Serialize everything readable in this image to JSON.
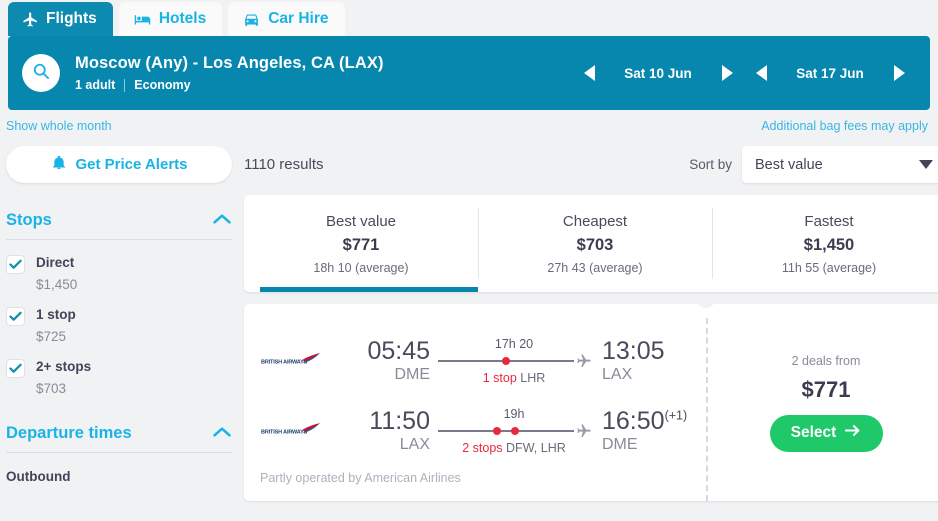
{
  "tabs": [
    {
      "label": "Flights",
      "icon": "plane-icon",
      "active": true
    },
    {
      "label": "Hotels",
      "icon": "bed-icon",
      "active": false
    },
    {
      "label": "Car Hire",
      "icon": "car-icon",
      "active": false
    }
  ],
  "search": {
    "icon": "search-icon",
    "route": "Moscow (Any) - Los Angeles, CA (LAX)",
    "passengers": "1 adult",
    "cabin": "Economy",
    "depart_date": "Sat 10 Jun",
    "return_date": "Sat 17 Jun",
    "prev_icon": "chevron-left-icon",
    "next_icon": "chevron-right-icon"
  },
  "links": {
    "show_whole_month": "Show whole month",
    "bag_fees": "Additional bag fees may apply"
  },
  "toolbar": {
    "price_alerts": "Get Price Alerts",
    "bell_icon": "bell-icon",
    "results_count": "1110 results",
    "sort_label": "Sort by",
    "sort_value": "Best value",
    "sort_caret": "chevron-down-icon"
  },
  "compare": [
    {
      "name": "Best value",
      "price": "$771",
      "duration": "18h 10 (average)",
      "active": true
    },
    {
      "name": "Cheapest",
      "price": "$703",
      "duration": "27h 43 (average)",
      "active": false
    },
    {
      "name": "Fastest",
      "price": "$1,450",
      "duration": "11h 55 (average)",
      "active": false
    }
  ],
  "filters": {
    "stops": {
      "title": "Stops",
      "chevron": "chevron-up-icon",
      "options": [
        {
          "label": "Direct",
          "price": "$1,450",
          "checked": true
        },
        {
          "label": "1 stop",
          "price": "$725",
          "checked": true
        },
        {
          "label": "2+ stops",
          "price": "$703",
          "checked": true
        }
      ]
    },
    "departure_times": {
      "title": "Departure times",
      "chevron": "chevron-up-icon",
      "outbound_label": "Outbound"
    }
  },
  "result": {
    "airline_logo": "british-airways-logo",
    "legs": [
      {
        "depart_time": "05:45",
        "depart_code": "DME",
        "duration": "17h 20",
        "stops_count": "1 stop",
        "stops_codes": "LHR",
        "stop_dots": 1,
        "arrive_time": "13:05",
        "arrive_day_offset": "",
        "arrive_code": "LAX"
      },
      {
        "depart_time": "11:50",
        "depart_code": "LAX",
        "duration": "19h",
        "stops_count": "2 stops",
        "stops_codes": "DFW, LHR",
        "stop_dots": 2,
        "arrive_time": "16:50",
        "arrive_day_offset": "(+1)",
        "arrive_code": "DME"
      }
    ],
    "operated_by": "Partly operated by American Airlines",
    "deals_from": "2 deals from",
    "deal_price": "$771",
    "select_label": "Select",
    "select_arrow": "arrow-right-icon"
  },
  "colors": {
    "teal": "#0786ae",
    "cyan": "#19b3e6",
    "green": "#1fc96a",
    "red": "#e8283c",
    "page_bg": "#f1f2f4"
  }
}
